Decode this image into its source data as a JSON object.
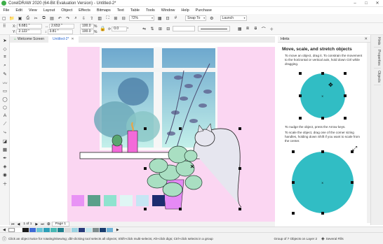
{
  "app": {
    "title": "CorelDRAW 2020 (64-Bit Evaluation Version) - Untitled-2*",
    "window_buttons": [
      "–",
      "□",
      "✕"
    ]
  },
  "menu": [
    "File",
    "Edit",
    "View",
    "Layout",
    "Object",
    "Effects",
    "Bitmaps",
    "Text",
    "Table",
    "Tools",
    "Window",
    "Help",
    "Purchase"
  ],
  "std_toolbar": {
    "zoom": "72%",
    "snap_to": "Snap To",
    "launch": "Launch"
  },
  "property_bar": {
    "x_label": "X:",
    "x_value": "6.681 \"",
    "y_label": "Y:",
    "y_value": "2.122 \"",
    "w_value": "2.653 \"",
    "h_value": "3.81 \"",
    "scale_w": "100.0",
    "scale_h": "100.0",
    "scale_unit": "%",
    "rotation": "0.0",
    "rotation_unit": "°"
  },
  "doc_tabs": [
    "Welcome Screen",
    "Untitled-2*"
  ],
  "hints": {
    "panel_title": "Hints",
    "heading": "Move, scale, and stretch objects",
    "p1": "To move an object, drag it. To constrain the movement to the horizontal or vertical axis, hold down Ctrl while dragging.",
    "p2": "To nudge the object, press the Arrow keys.",
    "p3": "To scale the object, drag one of the corner sizing handles, holding down Shift if you want to scale from the center."
  },
  "side_tabs": [
    "Hints",
    "Properties",
    "Objects"
  ],
  "page_nav": {
    "counter": "1 of 1",
    "page_label": "Page 1"
  },
  "palette": [
    "#ffffff",
    "#1a1a1a",
    "#3f6bd6",
    "#69c5d6",
    "#2c9fb8",
    "#48b9b4",
    "#1e7f8c",
    "#d9d9d9",
    "#9ad3e2",
    "#273b7a",
    "#c2e7ee",
    "#7e8c8d",
    "#1a3d6e",
    "#6fb2d7"
  ],
  "status": {
    "message": "Click an object twice for rotating/skewing; dbl-clicking tool selects all objects; Shift+click multi-selects; Alt+click digs; Ctrl+click selects in a group",
    "selection": "Group of 7 Objects on Layer 2",
    "fill": "Several Fills"
  },
  "artwork_swatches": [
    "#e893f5",
    "#5aa08a",
    "#8fe3cf",
    "#dff6f4",
    "#c6e6f4",
    "#1d2c70"
  ],
  "colors": {
    "accent": "#2f6bd0",
    "page": "#fbd6f2",
    "circle": "#31bdc4"
  }
}
